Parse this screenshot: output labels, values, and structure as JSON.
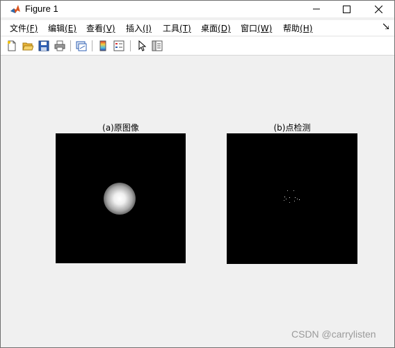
{
  "window": {
    "title": "Figure 1"
  },
  "menu": {
    "items": [
      {
        "label": "文件",
        "key": "(F)"
      },
      {
        "label": "编辑",
        "key": "(E)"
      },
      {
        "label": "查看",
        "key": "(V)"
      },
      {
        "label": "插入",
        "key": "(I)"
      },
      {
        "label": "工具",
        "key": "(T)"
      },
      {
        "label": "桌面",
        "key": "(D)"
      },
      {
        "label": "窗口",
        "key": "(W)"
      },
      {
        "label": "帮助",
        "key": "(H)"
      }
    ]
  },
  "toolbar": {
    "icons": [
      "new-figure-icon",
      "open-file-icon",
      "save-icon",
      "print-icon",
      "link-plot-icon",
      "colorbar-icon",
      "legend-icon",
      "pointer-icon",
      "property-editor-icon"
    ]
  },
  "figure": {
    "axes": [
      {
        "title": "(a)原图像"
      },
      {
        "title": "(b)点检测"
      }
    ]
  },
  "watermark": "CSDN @carrylisten",
  "side_marker": "i",
  "colors": {
    "axes_bg": "#000000",
    "figure_bg": "#f0f0f0"
  }
}
